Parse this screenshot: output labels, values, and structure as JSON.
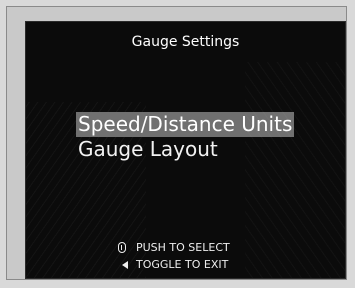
{
  "screen": {
    "title": "Gauge Settings"
  },
  "menu": {
    "items": [
      {
        "label": "Speed/Distance Units",
        "selected": true
      },
      {
        "label": "Gauge Layout",
        "selected": false
      }
    ]
  },
  "hints": {
    "push": {
      "icon": "thumbwheel-push-icon",
      "text": "PUSH TO SELECT"
    },
    "toggle": {
      "icon": "left-arrow-icon",
      "text": "TOGGLE TO EXIT"
    }
  },
  "colors": {
    "screen_bg": "#0b0b0b",
    "highlight": "#707070",
    "frame": "#c9c9c9"
  }
}
